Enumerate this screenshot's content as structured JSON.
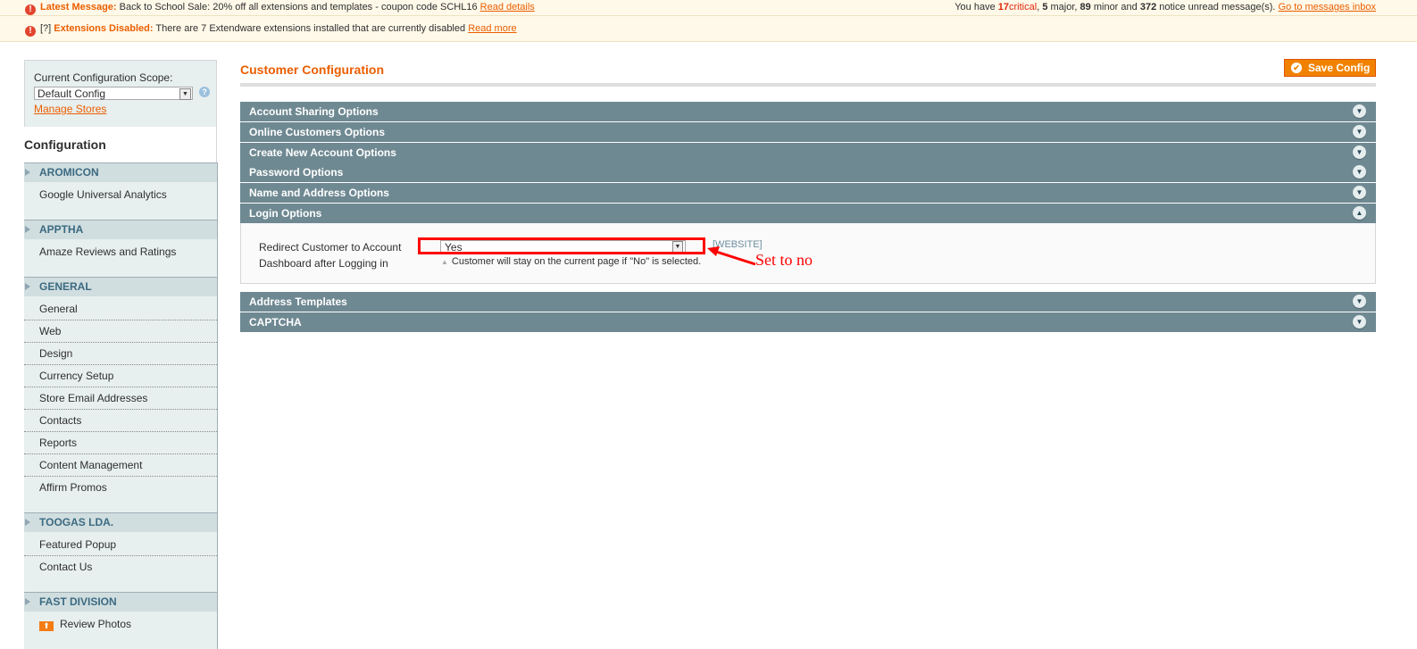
{
  "notices": {
    "latest": {
      "label": "Latest Message:",
      "text": "Back to School Sale: 20% off all extensions and templates - coupon code SCHL16",
      "link": "Read details"
    },
    "summary": {
      "prefix": "You have",
      "critical_count": "17",
      "critical_label": "critical",
      "major_count": "5",
      "major_label": "major,",
      "minor_count": "89",
      "minor_label": "minor and",
      "notice_count": "372",
      "notice_label": "notice unread message(s).",
      "link": "Go to messages inbox"
    },
    "extensions": {
      "help": "[?]",
      "label": "Extensions Disabled:",
      "text": "There are 7 Extendware extensions installed that are currently disabled",
      "link": "Read more"
    }
  },
  "scope": {
    "label": "Current Configuration Scope:",
    "value": "Default Config",
    "manage_link": "Manage Stores"
  },
  "sidebar": {
    "title": "Configuration",
    "groups": [
      {
        "label": "AROMICON",
        "items": [
          "Google Universal Analytics"
        ]
      },
      {
        "label": "APPTHA",
        "items": [
          "Amaze Reviews and Ratings"
        ]
      },
      {
        "label": "GENERAL",
        "items": [
          "General",
          "Web",
          "Design",
          "Currency Setup",
          "Store Email Addresses",
          "Contacts",
          "Reports",
          "Content Management",
          "Affirm Promos"
        ]
      },
      {
        "label": "TOOGAS LDA.",
        "items": [
          "Featured Popup",
          "Contact Us"
        ]
      },
      {
        "label": "FAST DIVISION",
        "items": [
          "Review Photos"
        ]
      }
    ]
  },
  "main": {
    "title": "Customer Configuration",
    "save_label": "Save Config",
    "sections": [
      "Account Sharing Options",
      "Online Customers Options",
      "Create New Account Options",
      "Password Options",
      "Name and Address Options",
      "Login Options",
      "Address Templates",
      "CAPTCHA"
    ],
    "login": {
      "field_label_line1": "Redirect Customer to Account",
      "field_label_line2": "Dashboard after Logging in",
      "value": "Yes",
      "scope": "[WEBSITE]",
      "note": "Customer will stay on the current page if \"No\" is selected."
    }
  },
  "annotation": {
    "text": "Set to no",
    "color": "#ff0000"
  }
}
